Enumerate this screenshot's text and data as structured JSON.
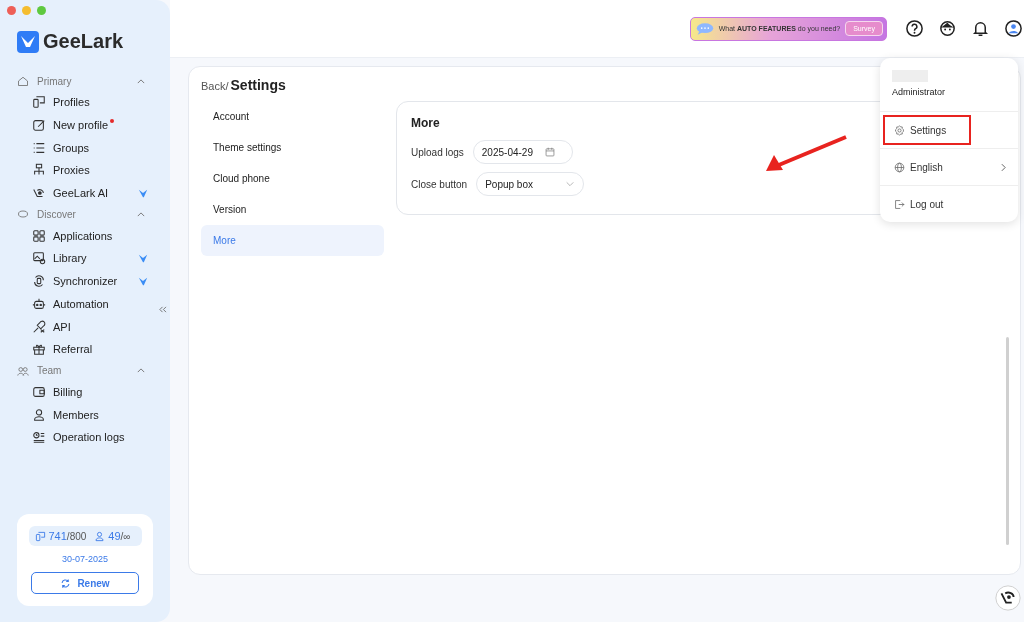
{
  "app": {
    "name": "GeeLark"
  },
  "sidebar": {
    "sections": [
      {
        "title": "Primary",
        "expanded": true,
        "items": [
          {
            "label": "Profiles",
            "new": false,
            "ai": false
          },
          {
            "label": "New profile",
            "new": true,
            "ai": false
          },
          {
            "label": "Groups",
            "new": false,
            "ai": false
          },
          {
            "label": "Proxies",
            "new": false,
            "ai": false
          },
          {
            "label": "GeeLark AI",
            "new": false,
            "ai": true
          }
        ]
      },
      {
        "title": "Discover",
        "expanded": true,
        "items": [
          {
            "label": "Applications",
            "new": false,
            "ai": false
          },
          {
            "label": "Library",
            "new": false,
            "ai": true
          },
          {
            "label": "Synchronizer",
            "new": false,
            "ai": true
          },
          {
            "label": "Automation",
            "new": false,
            "ai": false
          },
          {
            "label": "API",
            "new": false,
            "ai": false
          },
          {
            "label": "Referral",
            "new": false,
            "ai": false
          }
        ]
      },
      {
        "title": "Team",
        "expanded": true,
        "items": [
          {
            "label": "Billing",
            "new": false,
            "ai": false
          },
          {
            "label": "Members",
            "new": false,
            "ai": false
          },
          {
            "label": "Operation logs",
            "new": false,
            "ai": false
          }
        ]
      }
    ],
    "plan": {
      "profiles_used": "741",
      "profiles_total": "/800",
      "members_used": "49",
      "members_total": "/∞",
      "expiry": "30-07-2025",
      "renew_button": "Renew"
    }
  },
  "header": {
    "survey_banner": {
      "text": "What **AUTO FEATURES** do you need?",
      "button": "Survey"
    }
  },
  "page": {
    "back_link": "Back/",
    "title": "Settings",
    "menu": [
      {
        "label": "Account",
        "selected": false
      },
      {
        "label": "Theme settings",
        "selected": false
      },
      {
        "label": "Cloud phone",
        "selected": false
      },
      {
        "label": "Version",
        "selected": false
      },
      {
        "label": "More",
        "selected": true
      }
    ],
    "panel": {
      "title": "More",
      "fields": [
        {
          "label": "Upload logs",
          "kind": "date",
          "value": "2025-04-29"
        },
        {
          "label": "Close button",
          "kind": "select",
          "value": "Popup box"
        }
      ]
    }
  },
  "user_menu": {
    "role": "Administrator",
    "items": [
      {
        "label": "Settings",
        "highlighted": true,
        "submenu": false
      },
      {
        "label": "English",
        "highlighted": false,
        "submenu": true
      },
      {
        "label": "Log out",
        "highlighted": false,
        "submenu": false
      }
    ]
  }
}
